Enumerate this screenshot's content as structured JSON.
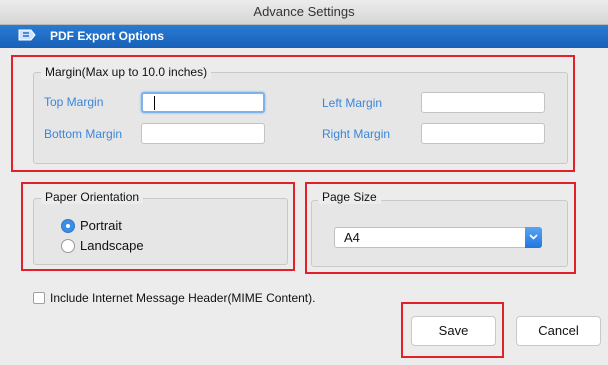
{
  "window": {
    "title": "Advance Settings"
  },
  "header": {
    "title": "PDF Export Options",
    "icon": "pdf-export-icon"
  },
  "margin": {
    "legend": "Margin(Max up to 10.0 inches)",
    "top_label": "Top Margin",
    "top_value": "",
    "bottom_label": "Bottom Margin",
    "bottom_value": "",
    "left_label": "Left Margin",
    "left_value": "",
    "right_label": "Right Margin",
    "right_value": ""
  },
  "orientation": {
    "legend": "Paper Orientation",
    "options": [
      "Portrait",
      "Landscape"
    ],
    "selected": "Portrait"
  },
  "page_size": {
    "legend": "Page Size",
    "selected": "A4"
  },
  "mime": {
    "label": "Include Internet Message Header(MIME Content).",
    "checked": false
  },
  "buttons": {
    "save": "Save",
    "cancel": "Cancel"
  },
  "colors": {
    "header_blue": "#1f6fc8",
    "label_blue": "#3b86d9",
    "highlight_red": "#e3212a"
  }
}
